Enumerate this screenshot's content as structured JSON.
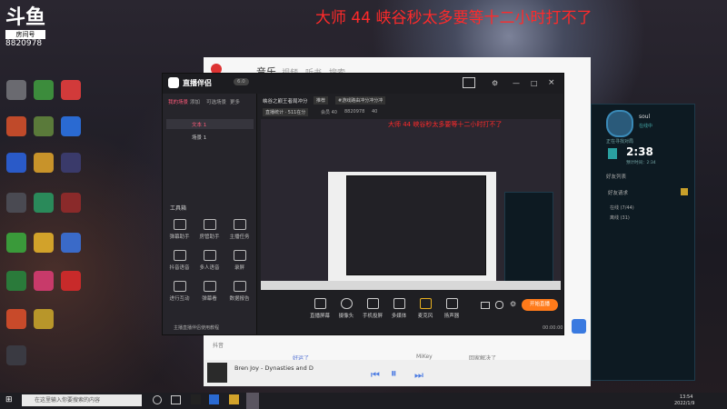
{
  "overlay": {
    "title": "大师 44 峡谷秒太多要等十二小时打不了"
  },
  "douyu": {
    "logo": "斗鱼",
    "room_label": "房间号",
    "room_number": "8820978"
  },
  "music": {
    "nav_tabs": [
      "音乐",
      "视频",
      "听书",
      "搜索"
    ],
    "now_playing": "Bren Joy - Dynasties and D",
    "rows": [
      "抖音",
      "好运了"
    ],
    "artist": "MiKey",
    "misc": "回家解决了"
  },
  "stream_app": {
    "app_name": "直播伴侣",
    "version": "6.0",
    "left_tabs": [
      "我的场景",
      "添加",
      "可选场景",
      "更多"
    ],
    "scenes": [
      "文本 1",
      "场景 1"
    ],
    "toolbox_label": "工具箱",
    "tools": [
      "弹幕助手",
      "房管助手",
      "主播任务",
      "抖音语音",
      "多人语音",
      "录屏",
      "进行互动",
      "弹幕看",
      "数据报告"
    ],
    "footer": "主播直播伴侣使用教程",
    "room_title": "峡谷之巅王者局冲分",
    "tag1": "推荐",
    "tag2": "#游戏路由冲分冲分冲",
    "live_stats": "直播统计 · 511在分",
    "fans": "会员 40",
    "viewer_id": "8820978",
    "likes": "40",
    "preview_overlay": "大师 44 峡谷秒太多要等十二小时打不了",
    "controls": [
      "直播屏幕",
      "摄像头",
      "手机投屏",
      "多媒体",
      "麦克风",
      "扬声器"
    ],
    "start_button": "开始直播",
    "timer": "00:00:00"
  },
  "game_client": {
    "username": "soul",
    "status": "在线中",
    "queue_label": "正在寻找对局",
    "timer": "2:38",
    "timer_sub": "预计时间：2:34",
    "friends_header": "好友列表",
    "section": "好友请求",
    "groups": [
      "在线 (7/44)",
      "离线 (31)"
    ]
  },
  "taskbar": {
    "search_placeholder": "在这里输入你要搜索的内容",
    "time": "13:54",
    "date": "2022/1/9"
  }
}
